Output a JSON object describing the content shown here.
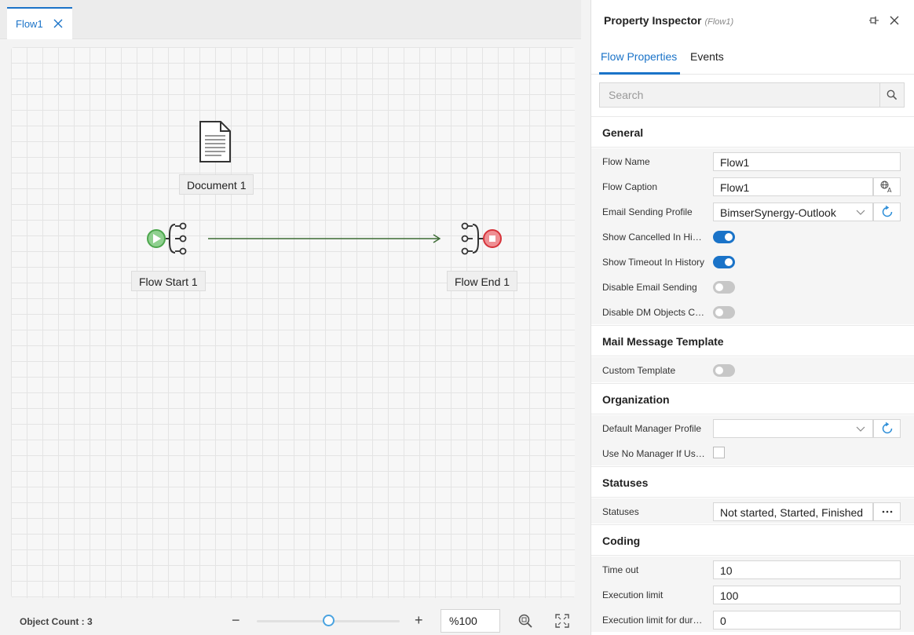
{
  "tab": {
    "label": "Flow1"
  },
  "canvas": {
    "nodes": [
      {
        "label": "Document 1"
      },
      {
        "label": "Flow Start 1"
      },
      {
        "label": "Flow End 1"
      }
    ]
  },
  "statusbar": {
    "object_count": "Object Count : 3",
    "zoom_minus": "−",
    "zoom_plus": "+",
    "zoom_value": "%100",
    "zoom_level": 0.5
  },
  "inspector": {
    "title": "Property Inspector",
    "subtitle": "(Flow1)",
    "tabs": [
      "Flow Properties",
      "Events"
    ],
    "search_placeholder": "Search",
    "sections": {
      "general": "General",
      "mail": "Mail Message Template",
      "organization": "Organization",
      "statuses": "Statuses",
      "coding": "Coding"
    },
    "props": {
      "flow_name": {
        "label": "Flow Name",
        "value": "Flow1"
      },
      "flow_caption": {
        "label": "Flow Caption",
        "value": "Flow1"
      },
      "email_profile": {
        "label": "Email Sending Profile",
        "value": "BimserSynergy-Outlook"
      },
      "show_cancelled": {
        "label": "Show Cancelled In History",
        "value": true
      },
      "show_timeout": {
        "label": "Show Timeout In History",
        "value": true
      },
      "disable_email": {
        "label": "Disable Email Sending",
        "value": false
      },
      "disable_dm": {
        "label": "Disable DM Objects Cache",
        "value": false
      },
      "custom_template": {
        "label": "Custom Template",
        "value": false
      },
      "default_manager": {
        "label": "Default Manager Profile",
        "value": ""
      },
      "use_no_manager": {
        "label": "Use No Manager If User Has No Manager",
        "value": false
      },
      "statuses": {
        "label": "Statuses",
        "value": "Not started, Started, Finished"
      },
      "time_out": {
        "label": "Time out",
        "value": "10"
      },
      "exec_limit": {
        "label": "Execution limit",
        "value": "100"
      },
      "exec_limit_dur": {
        "label": "Execution limit for duration",
        "value": "0"
      }
    }
  },
  "colors": {
    "accent": "#1a73c8",
    "start_green": "#5cb85c",
    "end_red": "#e0474c",
    "connector": "#3c6b34"
  }
}
